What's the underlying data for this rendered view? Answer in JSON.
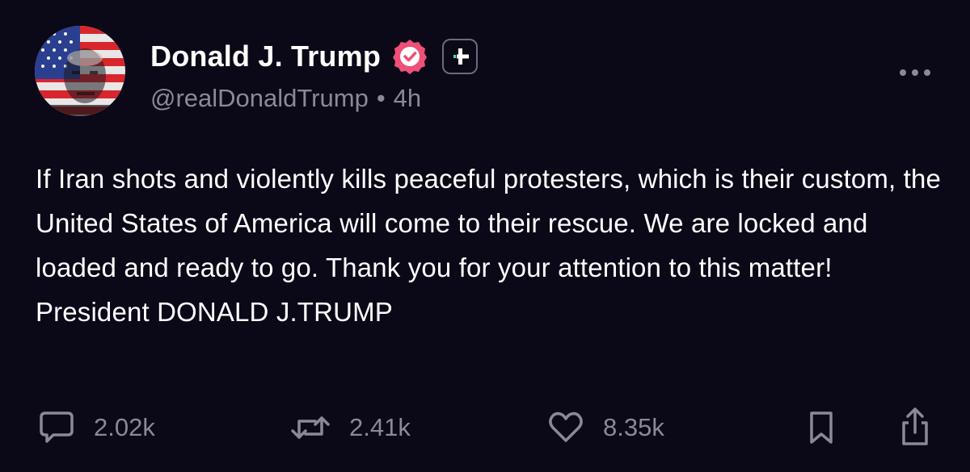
{
  "author": {
    "display_name": "Donald J. Trump",
    "handle": "@realDonaldTrump",
    "separator": "•",
    "time_ago": "4h",
    "verified": true,
    "verified_color": "#ef4f78",
    "follow_accent": "#3ee6c1"
  },
  "post": {
    "text": "If Iran shots and violently kills peaceful protesters, which is their custom, the United States of America will come to their rescue. We are locked and loaded and ready to go. Thank you for your attention to this matter! President DONALD J.TRUMP"
  },
  "actions": {
    "replies": "2.02k",
    "reposts": "2.41k",
    "likes": "8.35k"
  },
  "icons": {
    "more": "more-horizontal-icon",
    "reply": "speech-bubble-icon",
    "repost": "repost-arrows-icon",
    "like": "heart-icon",
    "bookmark": "bookmark-icon",
    "share": "share-icon",
    "verified": "verified-badge-icon",
    "follow": "plus-icon"
  },
  "colors": {
    "background": "#0b0817",
    "text_primary": "#ffffff",
    "text_secondary": "#8b8997"
  }
}
